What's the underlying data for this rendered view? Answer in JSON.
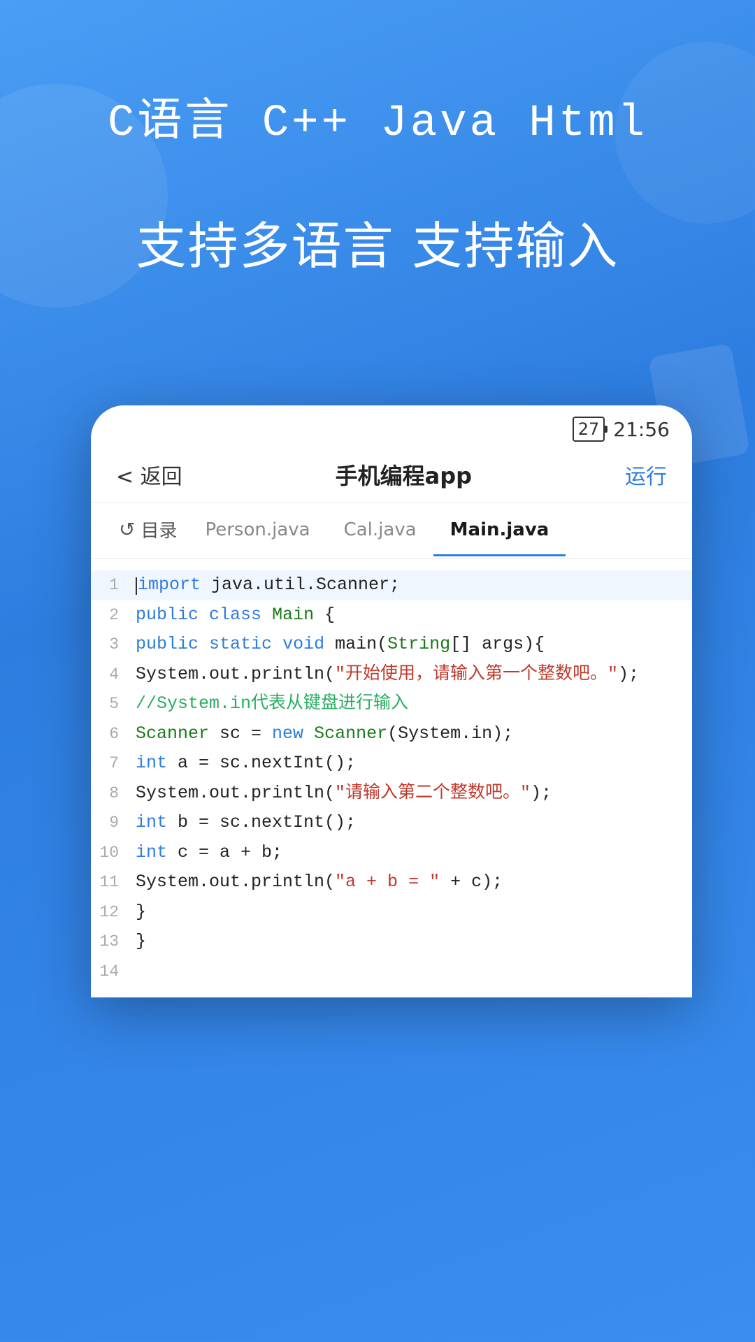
{
  "background": {
    "gradient_start": "#4a9ef5",
    "gradient_end": "#2d7de0"
  },
  "hero": {
    "line1": "C语言  C++  Java  Html",
    "line2": "支持多语言  支持输入"
  },
  "status_bar": {
    "battery": "27",
    "time": "21:56"
  },
  "app_bar": {
    "back_label": "< 返回",
    "title": "手机编程app",
    "run_label": "运行"
  },
  "tabs": [
    {
      "id": "folder",
      "label": "目录",
      "icon": "↺",
      "active": false
    },
    {
      "id": "person",
      "label": "Person.java",
      "active": false
    },
    {
      "id": "cal",
      "label": "Cal.java",
      "active": false
    },
    {
      "id": "main",
      "label": "Main.java",
      "active": true
    }
  ],
  "code": {
    "lines": [
      {
        "num": "1",
        "content": "import java.util.Scanner;",
        "type": "import"
      },
      {
        "num": "2",
        "content": "public class Main {",
        "type": "class_decl"
      },
      {
        "num": "3",
        "content": "    public static void main(String[] args){",
        "type": "method_decl"
      },
      {
        "num": "4",
        "content": "        System.out.println(\"开始使用，请输入第一个整数吧。\");",
        "type": "sysout"
      },
      {
        "num": "5",
        "content": "        //System.in代表从键盘进行输入",
        "type": "comment"
      },
      {
        "num": "6",
        "content": "        Scanner sc = new Scanner(System.in);",
        "type": "scanner"
      },
      {
        "num": "7",
        "content": "        int a = sc.nextInt();",
        "type": "int_decl"
      },
      {
        "num": "8",
        "content": "        System.out.println(\"请输入第二个整数吧。\");",
        "type": "sysout2"
      },
      {
        "num": "9",
        "content": "        int b = sc.nextInt();",
        "type": "int_decl2"
      },
      {
        "num": "10",
        "content": "        int c = a + b;",
        "type": "int_decl3"
      },
      {
        "num": "11",
        "content": "        System.out.println(\"a + b = \" + c);",
        "type": "sysout3"
      },
      {
        "num": "12",
        "content": "    }",
        "type": "brace"
      },
      {
        "num": "13",
        "content": "}",
        "type": "brace"
      },
      {
        "num": "14",
        "content": "",
        "type": "empty"
      }
    ]
  }
}
